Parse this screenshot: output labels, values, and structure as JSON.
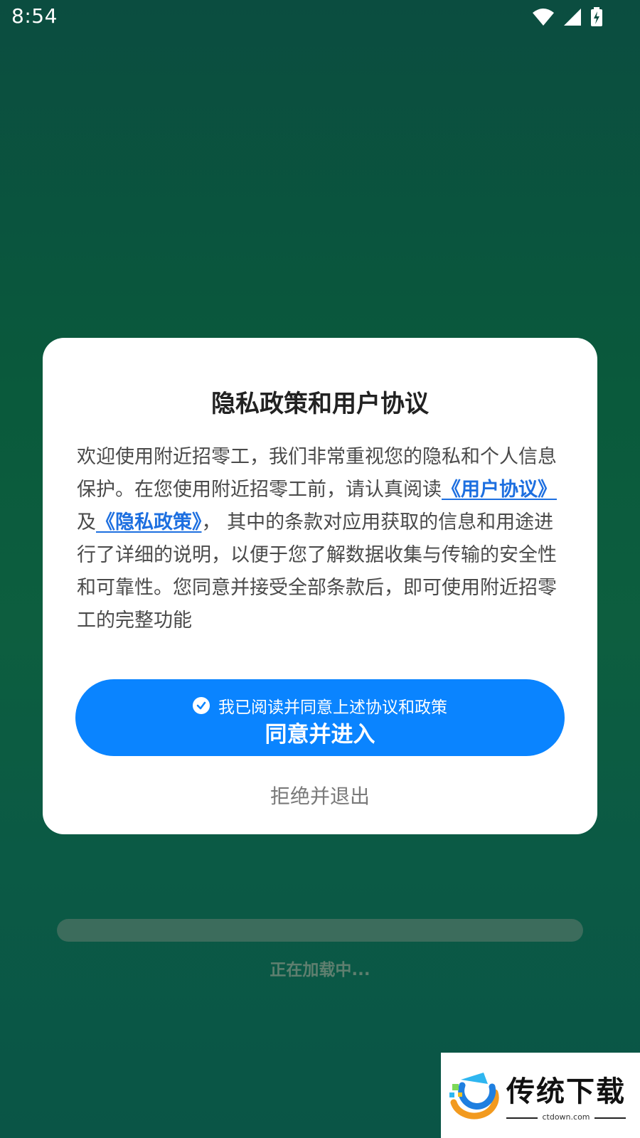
{
  "status_bar": {
    "time": "8:54",
    "icons": [
      "wifi-icon",
      "cell-signal-icon",
      "battery-charging-icon"
    ]
  },
  "dialog": {
    "title": "隐私政策和用户协议",
    "body": {
      "intro": "欢迎使用附近招零工，我们非常重视您的隐私和个人信息保护。在您使用附近招零工前，请认真阅读",
      "user_agreement_link": "《用户协议》",
      "conjunction": "及",
      "privacy_policy_link": "《隐私政策》",
      "rest": "， 其中的条款对应用获取的信息和用途进行了详细的说明，以便于您了解数据收集与传输的安全性和可靠性。您同意并接受全部条款后，即可使用附近招零工的完整功能"
    },
    "agree_checkbox_label": "我已阅读并同意上述协议和政策",
    "agree_button_label": "同意并进入",
    "reject_label": "拒绝并退出"
  },
  "loading": {
    "text": "正在加载中..."
  },
  "watermark": {
    "title": "传统下载",
    "domain": "ctdown.com"
  },
  "colors": {
    "accent": "#0a84ff",
    "link": "#1d6fe0",
    "background_start": "#0b4d40",
    "background_end": "#0a5546"
  }
}
